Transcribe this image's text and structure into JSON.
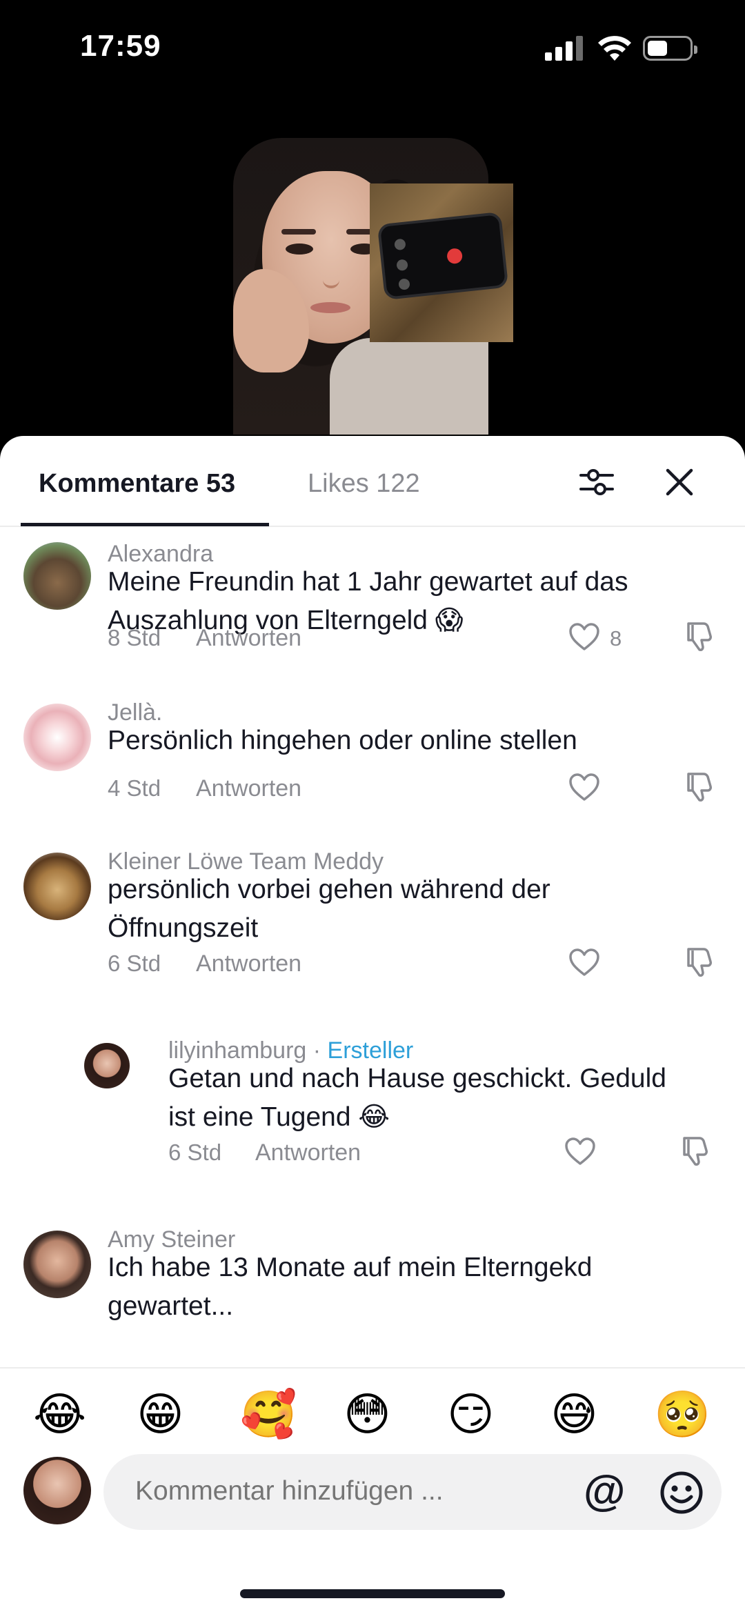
{
  "status_bar": {
    "time": "17:59",
    "battery_level": 0.45
  },
  "video": {
    "description_icon": "video-frame"
  },
  "sheet": {
    "tabs": [
      {
        "label": "Kommentare 53",
        "active": true
      },
      {
        "label": "Likes 122",
        "active": false
      }
    ]
  },
  "comments": [
    {
      "author": "Alexandra",
      "text_line1": "Meine Freundin hat 1 Jahr gewartet auf das",
      "text_line2": "Auszahlung von Elterngeld 😱",
      "time": "8 Std",
      "reply": "Antworten",
      "likes": "8"
    },
    {
      "author": "Jellà.",
      "text_line1": "Persönlich hingehen oder online stellen",
      "time": "4 Std",
      "reply": "Antworten"
    },
    {
      "author": "Kleiner Löwe Team Meddy",
      "text_line1": "persönlich vorbei gehen während der",
      "text_line2": "Öffnungszeit",
      "time": "6 Std",
      "reply": "Antworten"
    },
    {
      "author": "lilyinhamburg",
      "separator": " · ",
      "badge": "Ersteller",
      "text_line1": "Getan und nach Hause geschickt. Geduld",
      "text_line2": "ist eine Tugend 😂",
      "time": "6 Std",
      "reply": "Antworten"
    },
    {
      "author": "Amy Steiner",
      "text_line1": "Ich habe 13 Monate auf mein Elterngekd",
      "text_line2": "gewartet..."
    }
  ],
  "emoji_bar": [
    "😂",
    "😁",
    "🥰",
    "😳",
    "😏",
    "😅",
    "🥺"
  ],
  "input": {
    "placeholder": "Kommentar hinzufügen ...",
    "at_symbol": "@"
  },
  "colors": {
    "accent": "#2d9fd8",
    "text": "#161823",
    "muted": "#8a8b91"
  }
}
